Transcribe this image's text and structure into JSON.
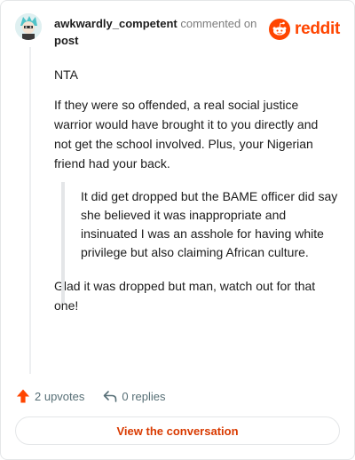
{
  "header": {
    "username": "awkwardly_competent",
    "commented_on": "commented on",
    "post_link": "post",
    "brand": "reddit"
  },
  "comment": {
    "paragraph_1": "NTA",
    "paragraph_2": "If they were so offended, a real social justice warrior would have brought it to you directly and not get the school involved. Plus, your Nigerian friend had your back.",
    "quote": "It did get dropped but the BAME officer did say she believed it was inappropriate and insinuated I was an asshole for having white privilege but also claiming African culture.",
    "paragraph_3": "Glad it was dropped but man, watch out for that one!"
  },
  "actions": {
    "upvotes": "2 upvotes",
    "replies": "0 replies",
    "upvote_icon": "upvote-arrow-icon",
    "reply_icon": "reply-arrow-icon"
  },
  "footer": {
    "view_conversation": "View the conversation"
  },
  "colors": {
    "brand": "#ff4500",
    "button_text": "#d93a00",
    "muted": "#576f76"
  }
}
